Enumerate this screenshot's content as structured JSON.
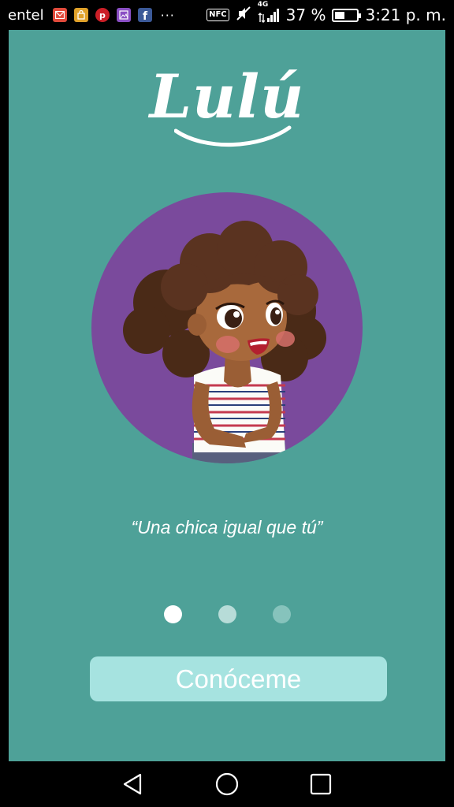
{
  "status_bar": {
    "carrier": "entel",
    "notifications": [
      {
        "icon": "mail-app-icon",
        "color": "#e14a3b"
      },
      {
        "icon": "store-app-icon",
        "color": "#e0a12a"
      },
      {
        "icon": "pinterest-icon",
        "color": "#cb1f27"
      },
      {
        "icon": "gallery-app-icon",
        "color": "#8a4fc4"
      },
      {
        "icon": "facebook-icon",
        "color": "#3b5998"
      }
    ],
    "more": "···",
    "nfc": "NFC",
    "network": "4G",
    "battery_text": "37 %",
    "battery_level": 0.37,
    "time": "3:21 p. m."
  },
  "app": {
    "logo": "Lulú",
    "tagline": "“Una chica igual que tú”",
    "pager": {
      "count": 3,
      "active": 0
    },
    "cta_label": "Conóceme",
    "colors": {
      "background": "#4ea198",
      "circle": "#7a4a9c",
      "button": "#a6e3e0",
      "dot_active": "#ffffff",
      "dot_inactive": "#b7dcd8",
      "dot_inactive_2": "#86c3bc"
    }
  },
  "nav_bar": {
    "buttons": [
      "back-icon",
      "home-icon",
      "recents-icon"
    ]
  }
}
